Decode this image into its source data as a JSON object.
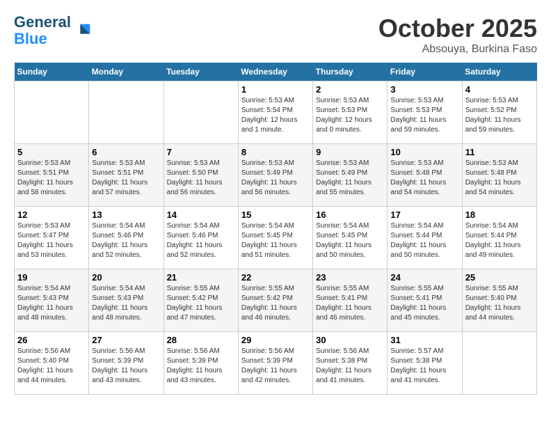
{
  "header": {
    "logo_line1": "General",
    "logo_line2": "Blue",
    "title": "October 2025",
    "subtitle": "Absouya, Burkina Faso"
  },
  "weekdays": [
    "Sunday",
    "Monday",
    "Tuesday",
    "Wednesday",
    "Thursday",
    "Friday",
    "Saturday"
  ],
  "weeks": [
    [
      {
        "day": "",
        "info": ""
      },
      {
        "day": "",
        "info": ""
      },
      {
        "day": "",
        "info": ""
      },
      {
        "day": "1",
        "info": "Sunrise: 5:53 AM\nSunset: 5:54 PM\nDaylight: 12 hours\nand 1 minute."
      },
      {
        "day": "2",
        "info": "Sunrise: 5:53 AM\nSunset: 5:53 PM\nDaylight: 12 hours\nand 0 minutes."
      },
      {
        "day": "3",
        "info": "Sunrise: 5:53 AM\nSunset: 5:53 PM\nDaylight: 11 hours\nand 59 minutes."
      },
      {
        "day": "4",
        "info": "Sunrise: 5:53 AM\nSunset: 5:52 PM\nDaylight: 11 hours\nand 59 minutes."
      }
    ],
    [
      {
        "day": "5",
        "info": "Sunrise: 5:53 AM\nSunset: 5:51 PM\nDaylight: 11 hours\nand 58 minutes."
      },
      {
        "day": "6",
        "info": "Sunrise: 5:53 AM\nSunset: 5:51 PM\nDaylight: 11 hours\nand 57 minutes."
      },
      {
        "day": "7",
        "info": "Sunrise: 5:53 AM\nSunset: 5:50 PM\nDaylight: 11 hours\nand 56 minutes."
      },
      {
        "day": "8",
        "info": "Sunrise: 5:53 AM\nSunset: 5:49 PM\nDaylight: 11 hours\nand 56 minutes."
      },
      {
        "day": "9",
        "info": "Sunrise: 5:53 AM\nSunset: 5:49 PM\nDaylight: 11 hours\nand 55 minutes."
      },
      {
        "day": "10",
        "info": "Sunrise: 5:53 AM\nSunset: 5:48 PM\nDaylight: 11 hours\nand 54 minutes."
      },
      {
        "day": "11",
        "info": "Sunrise: 5:53 AM\nSunset: 5:48 PM\nDaylight: 11 hours\nand 54 minutes."
      }
    ],
    [
      {
        "day": "12",
        "info": "Sunrise: 5:53 AM\nSunset: 5:47 PM\nDaylight: 11 hours\nand 53 minutes."
      },
      {
        "day": "13",
        "info": "Sunrise: 5:54 AM\nSunset: 5:46 PM\nDaylight: 11 hours\nand 52 minutes."
      },
      {
        "day": "14",
        "info": "Sunrise: 5:54 AM\nSunset: 5:46 PM\nDaylight: 11 hours\nand 52 minutes."
      },
      {
        "day": "15",
        "info": "Sunrise: 5:54 AM\nSunset: 5:45 PM\nDaylight: 11 hours\nand 51 minutes."
      },
      {
        "day": "16",
        "info": "Sunrise: 5:54 AM\nSunset: 5:45 PM\nDaylight: 11 hours\nand 50 minutes."
      },
      {
        "day": "17",
        "info": "Sunrise: 5:54 AM\nSunset: 5:44 PM\nDaylight: 11 hours\nand 50 minutes."
      },
      {
        "day": "18",
        "info": "Sunrise: 5:54 AM\nSunset: 5:44 PM\nDaylight: 11 hours\nand 49 minutes."
      }
    ],
    [
      {
        "day": "19",
        "info": "Sunrise: 5:54 AM\nSunset: 5:43 PM\nDaylight: 11 hours\nand 48 minutes."
      },
      {
        "day": "20",
        "info": "Sunrise: 5:54 AM\nSunset: 5:43 PM\nDaylight: 11 hours\nand 48 minutes."
      },
      {
        "day": "21",
        "info": "Sunrise: 5:55 AM\nSunset: 5:42 PM\nDaylight: 11 hours\nand 47 minutes."
      },
      {
        "day": "22",
        "info": "Sunrise: 5:55 AM\nSunset: 5:42 PM\nDaylight: 11 hours\nand 46 minutes."
      },
      {
        "day": "23",
        "info": "Sunrise: 5:55 AM\nSunset: 5:41 PM\nDaylight: 11 hours\nand 46 minutes."
      },
      {
        "day": "24",
        "info": "Sunrise: 5:55 AM\nSunset: 5:41 PM\nDaylight: 11 hours\nand 45 minutes."
      },
      {
        "day": "25",
        "info": "Sunrise: 5:55 AM\nSunset: 5:40 PM\nDaylight: 11 hours\nand 44 minutes."
      }
    ],
    [
      {
        "day": "26",
        "info": "Sunrise: 5:56 AM\nSunset: 5:40 PM\nDaylight: 11 hours\nand 44 minutes."
      },
      {
        "day": "27",
        "info": "Sunrise: 5:56 AM\nSunset: 5:39 PM\nDaylight: 11 hours\nand 43 minutes."
      },
      {
        "day": "28",
        "info": "Sunrise: 5:56 AM\nSunset: 5:39 PM\nDaylight: 11 hours\nand 43 minutes."
      },
      {
        "day": "29",
        "info": "Sunrise: 5:56 AM\nSunset: 5:39 PM\nDaylight: 11 hours\nand 42 minutes."
      },
      {
        "day": "30",
        "info": "Sunrise: 5:56 AM\nSunset: 5:38 PM\nDaylight: 11 hours\nand 41 minutes."
      },
      {
        "day": "31",
        "info": "Sunrise: 5:57 AM\nSunset: 5:38 PM\nDaylight: 11 hours\nand 41 minutes."
      },
      {
        "day": "",
        "info": ""
      }
    ]
  ]
}
